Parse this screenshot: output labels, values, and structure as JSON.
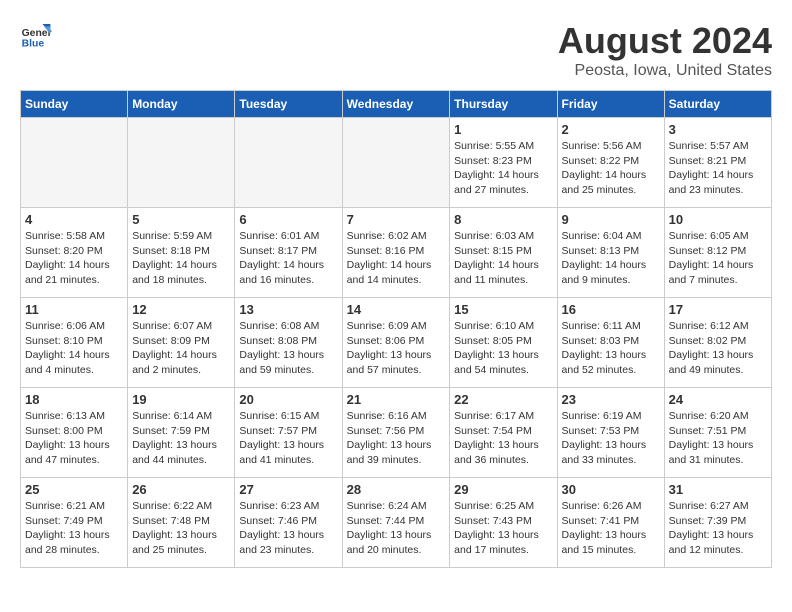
{
  "header": {
    "logo_line1": "General",
    "logo_line2": "Blue",
    "month_year": "August 2024",
    "location": "Peosta, Iowa, United States"
  },
  "weekdays": [
    "Sunday",
    "Monday",
    "Tuesday",
    "Wednesday",
    "Thursday",
    "Friday",
    "Saturday"
  ],
  "weeks": [
    [
      {
        "day": "",
        "empty": true
      },
      {
        "day": "",
        "empty": true
      },
      {
        "day": "",
        "empty": true
      },
      {
        "day": "",
        "empty": true
      },
      {
        "day": "1",
        "sunrise": "5:55 AM",
        "sunset": "8:23 PM",
        "daylight": "14 hours and 27 minutes."
      },
      {
        "day": "2",
        "sunrise": "5:56 AM",
        "sunset": "8:22 PM",
        "daylight": "14 hours and 25 minutes."
      },
      {
        "day": "3",
        "sunrise": "5:57 AM",
        "sunset": "8:21 PM",
        "daylight": "14 hours and 23 minutes."
      }
    ],
    [
      {
        "day": "4",
        "sunrise": "5:58 AM",
        "sunset": "8:20 PM",
        "daylight": "14 hours and 21 minutes."
      },
      {
        "day": "5",
        "sunrise": "5:59 AM",
        "sunset": "8:18 PM",
        "daylight": "14 hours and 18 minutes."
      },
      {
        "day": "6",
        "sunrise": "6:01 AM",
        "sunset": "8:17 PM",
        "daylight": "14 hours and 16 minutes."
      },
      {
        "day": "7",
        "sunrise": "6:02 AM",
        "sunset": "8:16 PM",
        "daylight": "14 hours and 14 minutes."
      },
      {
        "day": "8",
        "sunrise": "6:03 AM",
        "sunset": "8:15 PM",
        "daylight": "14 hours and 11 minutes."
      },
      {
        "day": "9",
        "sunrise": "6:04 AM",
        "sunset": "8:13 PM",
        "daylight": "14 hours and 9 minutes."
      },
      {
        "day": "10",
        "sunrise": "6:05 AM",
        "sunset": "8:12 PM",
        "daylight": "14 hours and 7 minutes."
      }
    ],
    [
      {
        "day": "11",
        "sunrise": "6:06 AM",
        "sunset": "8:10 PM",
        "daylight": "14 hours and 4 minutes."
      },
      {
        "day": "12",
        "sunrise": "6:07 AM",
        "sunset": "8:09 PM",
        "daylight": "14 hours and 2 minutes."
      },
      {
        "day": "13",
        "sunrise": "6:08 AM",
        "sunset": "8:08 PM",
        "daylight": "13 hours and 59 minutes."
      },
      {
        "day": "14",
        "sunrise": "6:09 AM",
        "sunset": "8:06 PM",
        "daylight": "13 hours and 57 minutes."
      },
      {
        "day": "15",
        "sunrise": "6:10 AM",
        "sunset": "8:05 PM",
        "daylight": "13 hours and 54 minutes."
      },
      {
        "day": "16",
        "sunrise": "6:11 AM",
        "sunset": "8:03 PM",
        "daylight": "13 hours and 52 minutes."
      },
      {
        "day": "17",
        "sunrise": "6:12 AM",
        "sunset": "8:02 PM",
        "daylight": "13 hours and 49 minutes."
      }
    ],
    [
      {
        "day": "18",
        "sunrise": "6:13 AM",
        "sunset": "8:00 PM",
        "daylight": "13 hours and 47 minutes."
      },
      {
        "day": "19",
        "sunrise": "6:14 AM",
        "sunset": "7:59 PM",
        "daylight": "13 hours and 44 minutes."
      },
      {
        "day": "20",
        "sunrise": "6:15 AM",
        "sunset": "7:57 PM",
        "daylight": "13 hours and 41 minutes."
      },
      {
        "day": "21",
        "sunrise": "6:16 AM",
        "sunset": "7:56 PM",
        "daylight": "13 hours and 39 minutes."
      },
      {
        "day": "22",
        "sunrise": "6:17 AM",
        "sunset": "7:54 PM",
        "daylight": "13 hours and 36 minutes."
      },
      {
        "day": "23",
        "sunrise": "6:19 AM",
        "sunset": "7:53 PM",
        "daylight": "13 hours and 33 minutes."
      },
      {
        "day": "24",
        "sunrise": "6:20 AM",
        "sunset": "7:51 PM",
        "daylight": "13 hours and 31 minutes."
      }
    ],
    [
      {
        "day": "25",
        "sunrise": "6:21 AM",
        "sunset": "7:49 PM",
        "daylight": "13 hours and 28 minutes."
      },
      {
        "day": "26",
        "sunrise": "6:22 AM",
        "sunset": "7:48 PM",
        "daylight": "13 hours and 25 minutes."
      },
      {
        "day": "27",
        "sunrise": "6:23 AM",
        "sunset": "7:46 PM",
        "daylight": "13 hours and 23 minutes."
      },
      {
        "day": "28",
        "sunrise": "6:24 AM",
        "sunset": "7:44 PM",
        "daylight": "13 hours and 20 minutes."
      },
      {
        "day": "29",
        "sunrise": "6:25 AM",
        "sunset": "7:43 PM",
        "daylight": "13 hours and 17 minutes."
      },
      {
        "day": "30",
        "sunrise": "6:26 AM",
        "sunset": "7:41 PM",
        "daylight": "13 hours and 15 minutes."
      },
      {
        "day": "31",
        "sunrise": "6:27 AM",
        "sunset": "7:39 PM",
        "daylight": "13 hours and 12 minutes."
      }
    ]
  ]
}
